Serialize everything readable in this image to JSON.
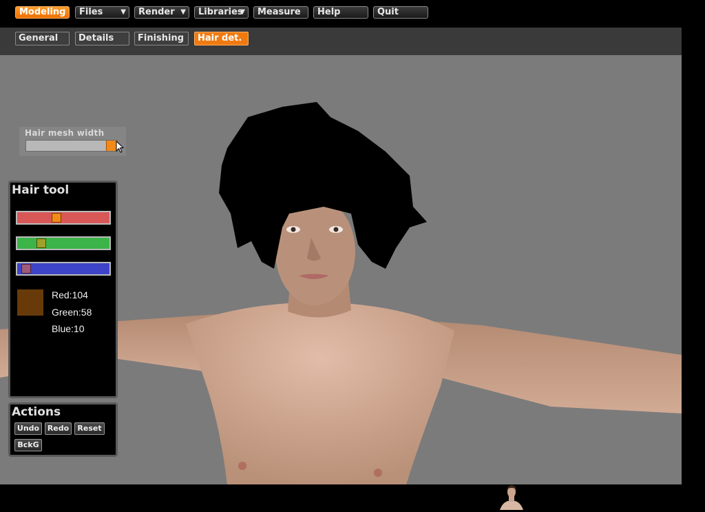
{
  "menu": {
    "items": [
      {
        "label": "Modeling",
        "active": true,
        "dropdown": false
      },
      {
        "label": "Files",
        "active": false,
        "dropdown": true
      },
      {
        "label": "Render",
        "active": false,
        "dropdown": true
      },
      {
        "label": "Libraries",
        "active": false,
        "dropdown": true
      },
      {
        "label": "Measure",
        "active": false,
        "dropdown": false
      },
      {
        "label": "Help",
        "active": false,
        "dropdown": false
      },
      {
        "label": "Quit",
        "active": false,
        "dropdown": false
      }
    ]
  },
  "tabs": {
    "items": [
      {
        "label": "General",
        "active": false
      },
      {
        "label": "Details",
        "active": false
      },
      {
        "label": "Finishing",
        "active": false
      },
      {
        "label": "Hair det.",
        "active": true
      }
    ]
  },
  "hair_mesh_width": {
    "label": "Hair mesh width",
    "value": 0.95
  },
  "hair_tool": {
    "title": "Hair tool",
    "red_label": "Red:104",
    "green_label": "Green:58",
    "blue_label": "Blue:10",
    "red": 104,
    "green": 58,
    "blue": 10,
    "swatch_color": "#683a0a"
  },
  "actions": {
    "title": "Actions",
    "undo": "Undo",
    "redo": "Redo",
    "reset": "Reset",
    "background": "BckG"
  },
  "colors": {
    "accent": "#f07a10",
    "viewport_bg": "#7b7b7b",
    "skin": "#c49a80",
    "slider_red": "#d85858",
    "slider_green": "#3cb44a",
    "slider_blue": "#3e44c8"
  },
  "icons": [
    "dropdown-caret-icon",
    "mouse-pointer-icon",
    "avatar-thumbnail-icon"
  ]
}
